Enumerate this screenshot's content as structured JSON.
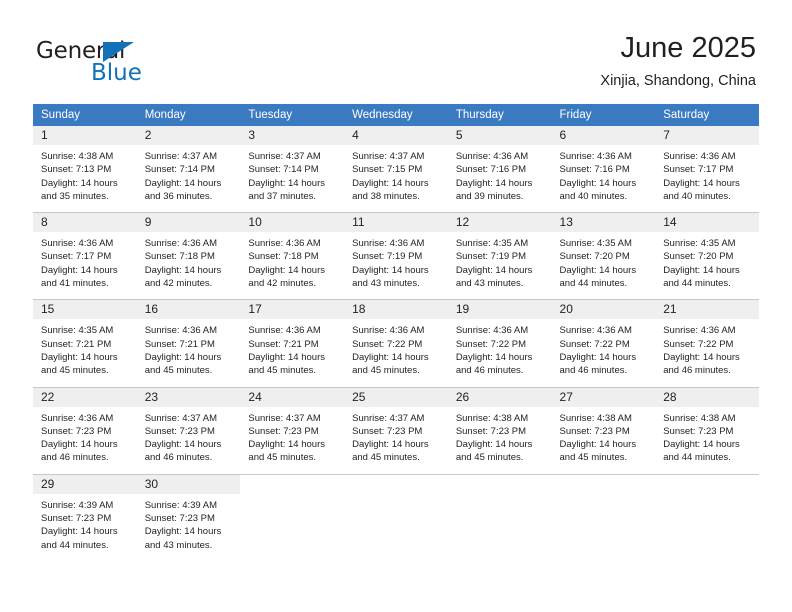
{
  "brand": {
    "name_dark": "General",
    "name_blue": "Blue",
    "accent_color": "#1272b8"
  },
  "header": {
    "title": "June 2025",
    "subtitle": "Xinjia, Shandong, China",
    "header_bg_color": "#3a7ac0",
    "daynum_bg_color": "#efefef"
  },
  "weekday_headers": [
    "Sunday",
    "Monday",
    "Tuesday",
    "Wednesday",
    "Thursday",
    "Friday",
    "Saturday"
  ],
  "labels": {
    "sunrise_prefix": "Sunrise:",
    "sunset_prefix": "Sunset:",
    "daylight_prefix": "Daylight:"
  },
  "weeks": [
    [
      {
        "day": "1",
        "sunrise": "Sunrise: 4:38 AM",
        "sunset": "Sunset: 7:13 PM",
        "daylight1": "Daylight: 14 hours",
        "daylight2": "and 35 minutes."
      },
      {
        "day": "2",
        "sunrise": "Sunrise: 4:37 AM",
        "sunset": "Sunset: 7:14 PM",
        "daylight1": "Daylight: 14 hours",
        "daylight2": "and 36 minutes."
      },
      {
        "day": "3",
        "sunrise": "Sunrise: 4:37 AM",
        "sunset": "Sunset: 7:14 PM",
        "daylight1": "Daylight: 14 hours",
        "daylight2": "and 37 minutes."
      },
      {
        "day": "4",
        "sunrise": "Sunrise: 4:37 AM",
        "sunset": "Sunset: 7:15 PM",
        "daylight1": "Daylight: 14 hours",
        "daylight2": "and 38 minutes."
      },
      {
        "day": "5",
        "sunrise": "Sunrise: 4:36 AM",
        "sunset": "Sunset: 7:16 PM",
        "daylight1": "Daylight: 14 hours",
        "daylight2": "and 39 minutes."
      },
      {
        "day": "6",
        "sunrise": "Sunrise: 4:36 AM",
        "sunset": "Sunset: 7:16 PM",
        "daylight1": "Daylight: 14 hours",
        "daylight2": "and 40 minutes."
      },
      {
        "day": "7",
        "sunrise": "Sunrise: 4:36 AM",
        "sunset": "Sunset: 7:17 PM",
        "daylight1": "Daylight: 14 hours",
        "daylight2": "and 40 minutes."
      }
    ],
    [
      {
        "day": "8",
        "sunrise": "Sunrise: 4:36 AM",
        "sunset": "Sunset: 7:17 PM",
        "daylight1": "Daylight: 14 hours",
        "daylight2": "and 41 minutes."
      },
      {
        "day": "9",
        "sunrise": "Sunrise: 4:36 AM",
        "sunset": "Sunset: 7:18 PM",
        "daylight1": "Daylight: 14 hours",
        "daylight2": "and 42 minutes."
      },
      {
        "day": "10",
        "sunrise": "Sunrise: 4:36 AM",
        "sunset": "Sunset: 7:18 PM",
        "daylight1": "Daylight: 14 hours",
        "daylight2": "and 42 minutes."
      },
      {
        "day": "11",
        "sunrise": "Sunrise: 4:36 AM",
        "sunset": "Sunset: 7:19 PM",
        "daylight1": "Daylight: 14 hours",
        "daylight2": "and 43 minutes."
      },
      {
        "day": "12",
        "sunrise": "Sunrise: 4:35 AM",
        "sunset": "Sunset: 7:19 PM",
        "daylight1": "Daylight: 14 hours",
        "daylight2": "and 43 minutes."
      },
      {
        "day": "13",
        "sunrise": "Sunrise: 4:35 AM",
        "sunset": "Sunset: 7:20 PM",
        "daylight1": "Daylight: 14 hours",
        "daylight2": "and 44 minutes."
      },
      {
        "day": "14",
        "sunrise": "Sunrise: 4:35 AM",
        "sunset": "Sunset: 7:20 PM",
        "daylight1": "Daylight: 14 hours",
        "daylight2": "and 44 minutes."
      }
    ],
    [
      {
        "day": "15",
        "sunrise": "Sunrise: 4:35 AM",
        "sunset": "Sunset: 7:21 PM",
        "daylight1": "Daylight: 14 hours",
        "daylight2": "and 45 minutes."
      },
      {
        "day": "16",
        "sunrise": "Sunrise: 4:36 AM",
        "sunset": "Sunset: 7:21 PM",
        "daylight1": "Daylight: 14 hours",
        "daylight2": "and 45 minutes."
      },
      {
        "day": "17",
        "sunrise": "Sunrise: 4:36 AM",
        "sunset": "Sunset: 7:21 PM",
        "daylight1": "Daylight: 14 hours",
        "daylight2": "and 45 minutes."
      },
      {
        "day": "18",
        "sunrise": "Sunrise: 4:36 AM",
        "sunset": "Sunset: 7:22 PM",
        "daylight1": "Daylight: 14 hours",
        "daylight2": "and 45 minutes."
      },
      {
        "day": "19",
        "sunrise": "Sunrise: 4:36 AM",
        "sunset": "Sunset: 7:22 PM",
        "daylight1": "Daylight: 14 hours",
        "daylight2": "and 46 minutes."
      },
      {
        "day": "20",
        "sunrise": "Sunrise: 4:36 AM",
        "sunset": "Sunset: 7:22 PM",
        "daylight1": "Daylight: 14 hours",
        "daylight2": "and 46 minutes."
      },
      {
        "day": "21",
        "sunrise": "Sunrise: 4:36 AM",
        "sunset": "Sunset: 7:22 PM",
        "daylight1": "Daylight: 14 hours",
        "daylight2": "and 46 minutes."
      }
    ],
    [
      {
        "day": "22",
        "sunrise": "Sunrise: 4:36 AM",
        "sunset": "Sunset: 7:23 PM",
        "daylight1": "Daylight: 14 hours",
        "daylight2": "and 46 minutes."
      },
      {
        "day": "23",
        "sunrise": "Sunrise: 4:37 AM",
        "sunset": "Sunset: 7:23 PM",
        "daylight1": "Daylight: 14 hours",
        "daylight2": "and 46 minutes."
      },
      {
        "day": "24",
        "sunrise": "Sunrise: 4:37 AM",
        "sunset": "Sunset: 7:23 PM",
        "daylight1": "Daylight: 14 hours",
        "daylight2": "and 45 minutes."
      },
      {
        "day": "25",
        "sunrise": "Sunrise: 4:37 AM",
        "sunset": "Sunset: 7:23 PM",
        "daylight1": "Daylight: 14 hours",
        "daylight2": "and 45 minutes."
      },
      {
        "day": "26",
        "sunrise": "Sunrise: 4:38 AM",
        "sunset": "Sunset: 7:23 PM",
        "daylight1": "Daylight: 14 hours",
        "daylight2": "and 45 minutes."
      },
      {
        "day": "27",
        "sunrise": "Sunrise: 4:38 AM",
        "sunset": "Sunset: 7:23 PM",
        "daylight1": "Daylight: 14 hours",
        "daylight2": "and 45 minutes."
      },
      {
        "day": "28",
        "sunrise": "Sunrise: 4:38 AM",
        "sunset": "Sunset: 7:23 PM",
        "daylight1": "Daylight: 14 hours",
        "daylight2": "and 44 minutes."
      }
    ],
    [
      {
        "day": "29",
        "sunrise": "Sunrise: 4:39 AM",
        "sunset": "Sunset: 7:23 PM",
        "daylight1": "Daylight: 14 hours",
        "daylight2": "and 44 minutes."
      },
      {
        "day": "30",
        "sunrise": "Sunrise: 4:39 AM",
        "sunset": "Sunset: 7:23 PM",
        "daylight1": "Daylight: 14 hours",
        "daylight2": "and 43 minutes."
      },
      {
        "day": "",
        "sunrise": "",
        "sunset": "",
        "daylight1": "",
        "daylight2": ""
      },
      {
        "day": "",
        "sunrise": "",
        "sunset": "",
        "daylight1": "",
        "daylight2": ""
      },
      {
        "day": "",
        "sunrise": "",
        "sunset": "",
        "daylight1": "",
        "daylight2": ""
      },
      {
        "day": "",
        "sunrise": "",
        "sunset": "",
        "daylight1": "",
        "daylight2": ""
      },
      {
        "day": "",
        "sunrise": "",
        "sunset": "",
        "daylight1": "",
        "daylight2": ""
      }
    ]
  ]
}
